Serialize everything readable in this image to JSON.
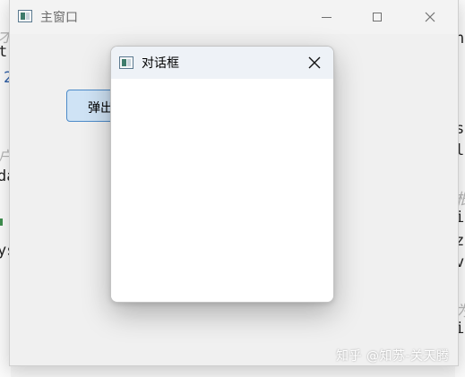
{
  "background_editor": {
    "left_glyphs": [
      "才",
      "t",
      "2",
      "户",
      "da",
      "ys"
    ],
    "right_glyphs": [
      "n",
      "s",
      "l",
      "根",
      "i",
      "z",
      "v(",
      "为",
      "i"
    ]
  },
  "main_window": {
    "title": "主窗口",
    "popup_button_label": "弹出"
  },
  "dialog": {
    "title": "对话框"
  },
  "watermark": "知乎 @知苏-关天腾",
  "colors": {
    "titlebar_bg": "#f3f3f3",
    "dialog_titlebar_bg": "#eef2f7",
    "button_bg": "#cfe3f5",
    "button_border": "#4d8bc9"
  }
}
